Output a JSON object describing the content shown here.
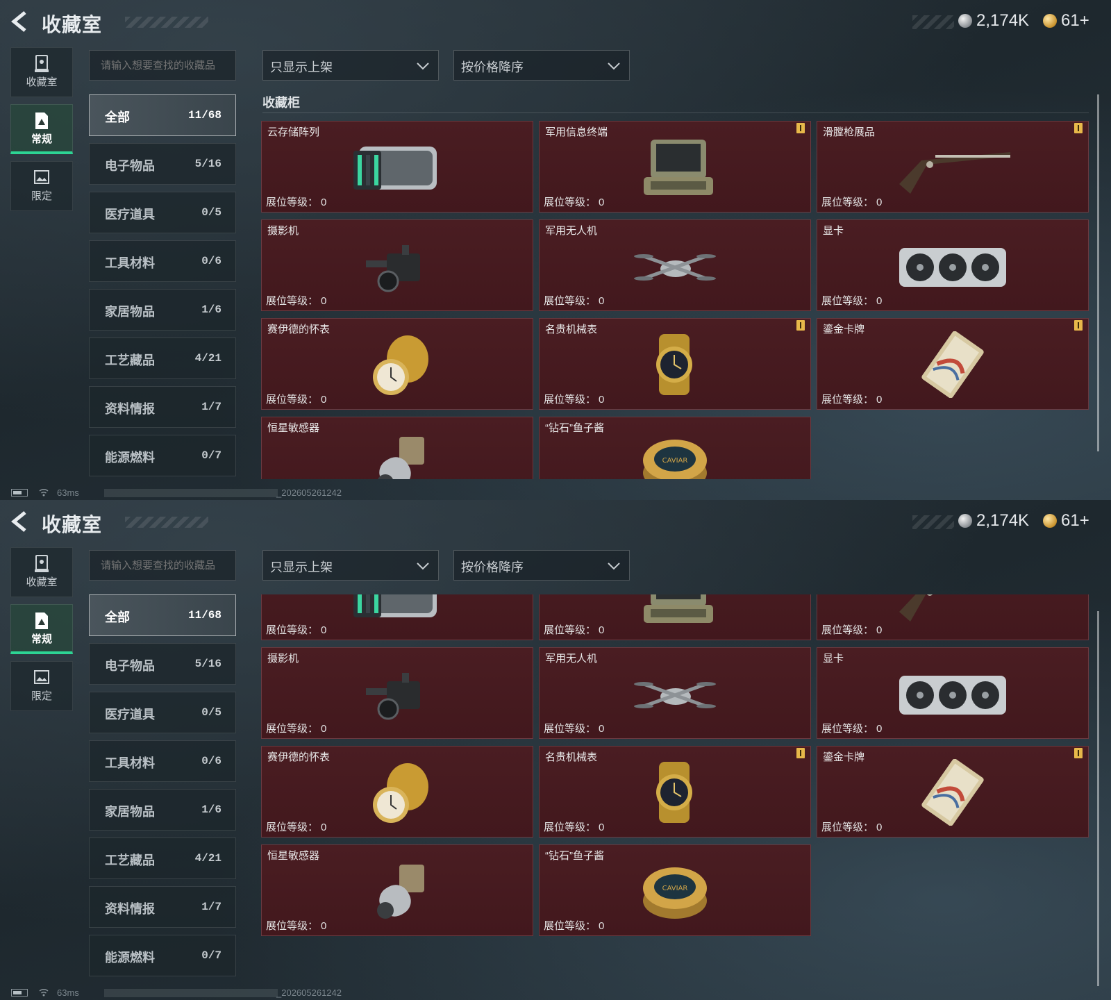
{
  "header": {
    "title": "收藏室",
    "currency_silver": "2,174K",
    "currency_gold": "61+"
  },
  "nav": [
    {
      "label": "收藏室",
      "icon": "display-case-icon",
      "active": false
    },
    {
      "label": "常规",
      "icon": "document-icon",
      "active": true
    },
    {
      "label": "限定",
      "icon": "image-frame-icon",
      "active": false
    }
  ],
  "search": {
    "placeholder": "请输入想要查找的收藏品"
  },
  "filters": {
    "display_filter": "只显示上架",
    "sort": "按价格降序"
  },
  "categories": [
    {
      "name": "全部",
      "count": "11/68",
      "active": true
    },
    {
      "name": "电子物品",
      "count": "5/16"
    },
    {
      "name": "医疗道具",
      "count": "0/5"
    },
    {
      "name": "工具材料",
      "count": "0/6"
    },
    {
      "name": "家居物品",
      "count": "1/6"
    },
    {
      "name": "工艺藏品",
      "count": "4/21"
    },
    {
      "name": "资料情报",
      "count": "1/7"
    },
    {
      "name": "能源燃料",
      "count": "0/7"
    }
  ],
  "section_title": "收藏柜",
  "level_label": "展位等级：",
  "items": [
    {
      "name": "云存储阵列",
      "level": "0",
      "alert": false,
      "icon": "storage-array-icon"
    },
    {
      "name": "军用信息终端",
      "level": "0",
      "alert": true,
      "icon": "field-terminal-icon"
    },
    {
      "name": "滑膛枪展品",
      "level": "0",
      "alert": true,
      "icon": "musket-icon"
    },
    {
      "name": "摄影机",
      "level": "0",
      "alert": false,
      "icon": "camera-icon"
    },
    {
      "name": "军用无人机",
      "level": "0",
      "alert": false,
      "icon": "drone-icon"
    },
    {
      "name": "显卡",
      "level": "0",
      "alert": false,
      "icon": "graphics-card-icon"
    },
    {
      "name": "赛伊德的怀表",
      "level": "0",
      "alert": false,
      "icon": "pocket-watch-icon"
    },
    {
      "name": "名贵机械表",
      "level": "0",
      "alert": true,
      "icon": "wristwatch-icon"
    },
    {
      "name": "鎏金卡牌",
      "level": "0",
      "alert": true,
      "icon": "gilded-card-icon"
    },
    {
      "name": "恒星敏感器",
      "level": "0",
      "alert": false,
      "icon": "star-sensor-icon"
    },
    {
      "name": "“钻石”鱼子酱",
      "level": "0",
      "alert": false,
      "icon": "caviar-tin-icon"
    }
  ],
  "footer": {
    "ping": "63ms",
    "build": "_202605261242"
  }
}
